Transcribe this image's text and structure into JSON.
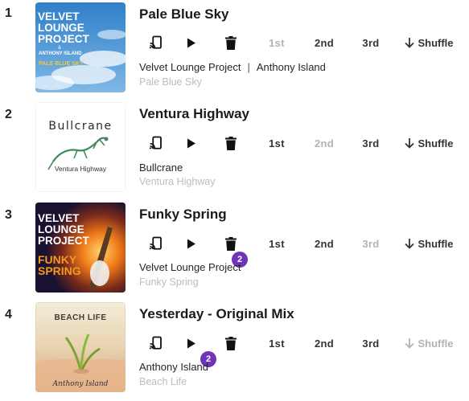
{
  "colors": {
    "badge": "#7034b8",
    "disabled": "#b3b3b3",
    "album_text": "#bdbdbd"
  },
  "controls": {
    "first_label": "1st",
    "second_label": "2nd",
    "third_label": "3rd",
    "shuffle_label": "Shuffle",
    "icons": [
      "cast-icon",
      "play-icon",
      "delete-icon",
      "arrow-down-icon"
    ]
  },
  "tracks": [
    {
      "rank": "1",
      "title": "Pale Blue Sky",
      "artists": [
        "Velvet Lounge Project",
        "Anthony Island"
      ],
      "separator": "|",
      "album": "Pale Blue Sky",
      "art": {
        "line1": "VELVET",
        "line2": "LOUNGE",
        "line3": "PROJECT",
        "line4": "&",
        "line5": "ANTHONY ISLAND",
        "line6": "PALE BLUE SKY"
      },
      "disabled": [
        "1st"
      ]
    },
    {
      "rank": "2",
      "title": "Ventura Highway",
      "artists": [
        "Bullcrane"
      ],
      "album": "Ventura Highway",
      "art": {
        "line1": "Bullcrane",
        "line2": "Ventura Highway"
      },
      "disabled": [
        "2nd"
      ]
    },
    {
      "rank": "3",
      "title": "Funky Spring",
      "artists": [
        "Velvet Lounge Project"
      ],
      "album": "Funky Spring",
      "badge": "2",
      "art": {
        "line1": "VELVET",
        "line2": "LOUNGE",
        "line3": "PROJECT",
        "line4": "FUNKY",
        "line5": "SPRING"
      },
      "disabled": [
        "3rd"
      ]
    },
    {
      "rank": "4",
      "title": "Yesterday - Original Mix",
      "artists": [
        "Anthony Island"
      ],
      "album": "Beach Life",
      "badge": "2",
      "art": {
        "line1": "BEACH LIFE",
        "line2": "Anthony Island"
      },
      "disabled": [
        "Shuffle"
      ]
    }
  ]
}
